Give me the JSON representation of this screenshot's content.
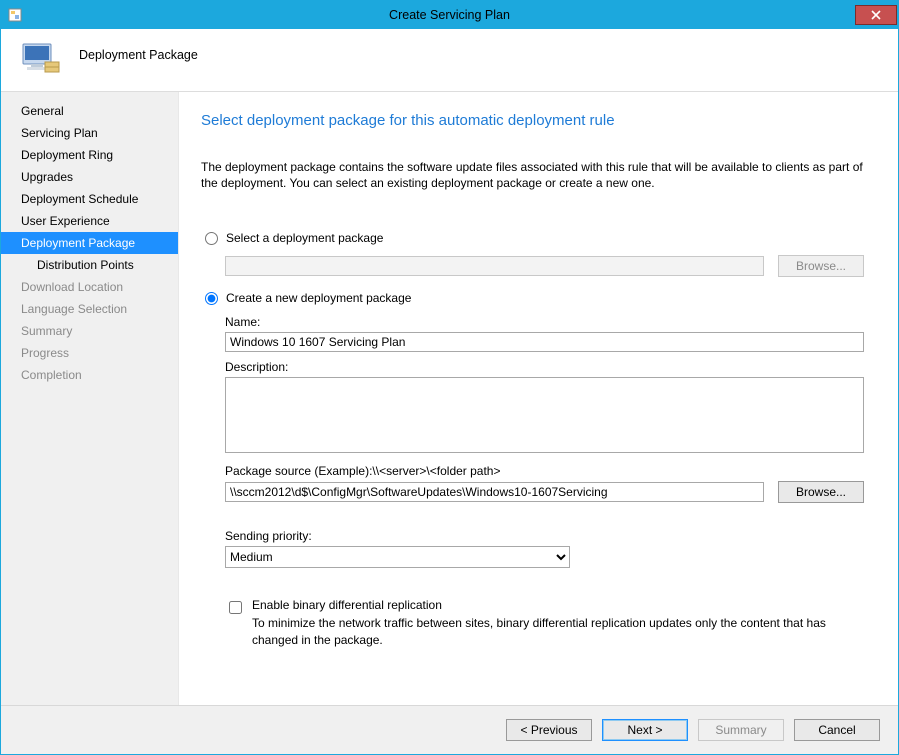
{
  "window": {
    "title": "Create Servicing Plan"
  },
  "header": {
    "page_name": "Deployment Package"
  },
  "sidebar": {
    "items": [
      {
        "label": "General",
        "state": "normal"
      },
      {
        "label": "Servicing Plan",
        "state": "normal"
      },
      {
        "label": "Deployment Ring",
        "state": "normal"
      },
      {
        "label": "Upgrades",
        "state": "normal"
      },
      {
        "label": "Deployment Schedule",
        "state": "normal"
      },
      {
        "label": "User Experience",
        "state": "normal"
      },
      {
        "label": "Deployment Package",
        "state": "selected"
      },
      {
        "label": "Distribution Points",
        "state": "sub"
      },
      {
        "label": "Download Location",
        "state": "disabled"
      },
      {
        "label": "Language Selection",
        "state": "disabled"
      },
      {
        "label": "Summary",
        "state": "disabled"
      },
      {
        "label": "Progress",
        "state": "disabled"
      },
      {
        "label": "Completion",
        "state": "disabled"
      }
    ]
  },
  "content": {
    "heading": "Select deployment package for this automatic deployment rule",
    "intro": "The deployment package contains the software update files associated with this rule that will be available to clients as part of the deployment. You can select an existing deployment package or create a new one.",
    "select_pkg_label": "Select a deployment package",
    "select_pkg_value": "",
    "browse_label": "Browse...",
    "create_pkg_label": "Create a new deployment package",
    "name_label": "Name:",
    "name_value": "Windows 10 1607 Servicing Plan",
    "description_label": "Description:",
    "description_value": "",
    "pkg_source_label": "Package source (Example):\\\\<server>\\<folder path>",
    "pkg_source_value": "\\\\sccm2012\\d$\\ConfigMgr\\SoftwareUpdates\\Windows10-1607Servicing",
    "browse2_label": "Browse...",
    "priority_label": "Sending priority:",
    "priority_value": "Medium",
    "binary_diff_label": "Enable binary differential replication",
    "binary_diff_help": "To minimize the network traffic between sites, binary differential replication updates only the content that has changed in the package."
  },
  "footer": {
    "previous": "< Previous",
    "next": "Next >",
    "summary": "Summary",
    "cancel": "Cancel"
  }
}
